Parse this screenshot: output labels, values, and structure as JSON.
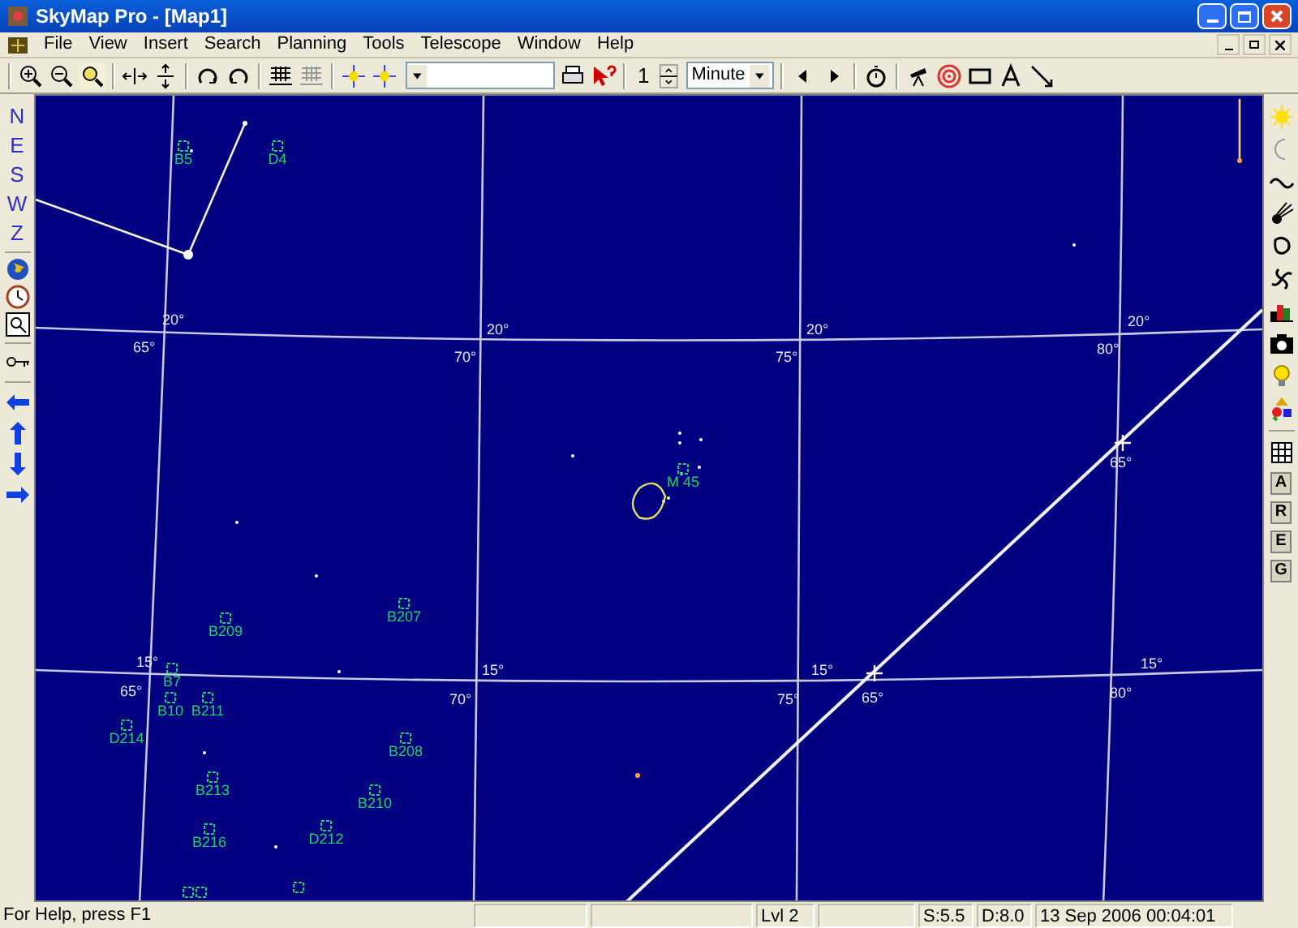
{
  "window": {
    "title": "SkyMap Pro - [Map1]"
  },
  "menu": [
    "File",
    "View",
    "Insert",
    "Search",
    "Planning",
    "Tools",
    "Telescope",
    "Window",
    "Help"
  ],
  "toolbar": {
    "step": {
      "value": "1"
    },
    "time_unit": {
      "value": "Minute"
    }
  },
  "left_toolbar": {
    "directions": [
      "N",
      "E",
      "S",
      "W",
      "Z"
    ]
  },
  "right_toolbar": {
    "letter_buttons": [
      "A",
      "R",
      "E",
      "G"
    ]
  },
  "map": {
    "grid_labels": [
      "20°",
      "65°",
      "20°",
      "70°",
      "20°",
      "75°",
      "20°",
      "80°",
      "65°",
      "15°",
      "65°",
      "15°",
      "70°",
      "15°",
      "75°",
      "65°",
      "15°",
      "80°"
    ],
    "objects": [
      "B5",
      "D4",
      "M 45",
      "B209",
      "B207",
      "B7",
      "B10",
      "B211",
      "D214",
      "B208",
      "B213",
      "B210",
      "B216",
      "D212"
    ]
  },
  "status_bar": [
    "For Help, press F1",
    "Lvl 2",
    "S:5.5",
    "D:8.0",
    "13 Sep 2006 00:04:01"
  ]
}
